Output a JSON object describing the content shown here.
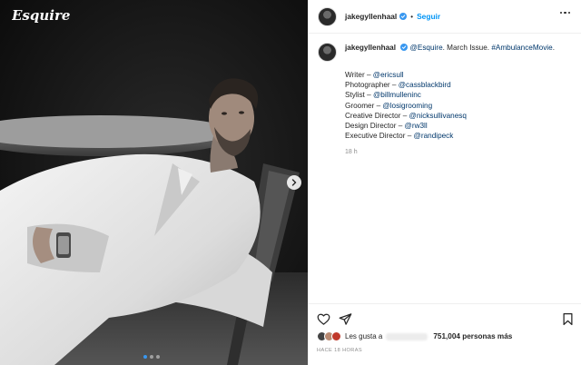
{
  "media": {
    "brand": "Esquire",
    "carousel_dots": 3,
    "active_dot": 0
  },
  "header": {
    "username": "jakegyllenhaal",
    "separator": "•",
    "follow_label": "Seguir"
  },
  "caption": {
    "username": "jakegyllenhaal",
    "mention": "@Esquire",
    "text": ". March Issue. ",
    "hashtag": "#AmbulanceMovie",
    "tail": ".",
    "credits": [
      {
        "role": "Writer – ",
        "handle": "@ericsull"
      },
      {
        "role": "Photographer – ",
        "handle": "@cassblackbird"
      },
      {
        "role": "Stylist – ",
        "handle": "@billmulleninc"
      },
      {
        "role": "Groomer – ",
        "handle": "@losigrooming"
      },
      {
        "role": "Creative Director – ",
        "handle": "@nicksullivanesq"
      },
      {
        "role": "Design Director – ",
        "handle": "@rw3ll"
      },
      {
        "role": "Executive Director – ",
        "handle": "@randipeck"
      }
    ],
    "age": "18 h"
  },
  "actions": {
    "likes_prefix": "Les gusta a",
    "likes_count": "751,004 personas más",
    "timestamp": "HACE 18 HORAS"
  },
  "colors": {
    "accent": "#0095f6",
    "link": "#00376b",
    "muted": "#8e8e8e",
    "active_dot": "#3897f0"
  },
  "icons": [
    "heart-icon",
    "share-icon",
    "bookmark-icon",
    "verified-icon",
    "more-icon",
    "chevron-right-icon"
  ]
}
